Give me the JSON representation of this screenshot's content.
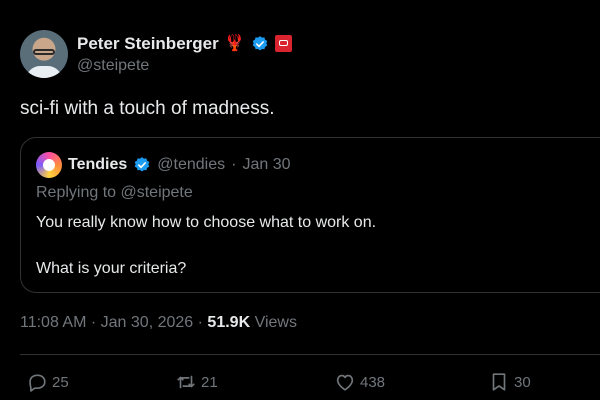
{
  "author": {
    "name": "Peter Steinberger",
    "handle": "@steipete",
    "emoji": "🦞"
  },
  "tweet": {
    "text": "sci-fi with a touch of madness."
  },
  "quote": {
    "name": "Tendies",
    "handle": "@tendies",
    "separator": "·",
    "date": "Jan 30",
    "reply_line": "Replying to @steipete",
    "line1": "You really know how to choose what to work on.",
    "line2": "What is your criteria?"
  },
  "meta": {
    "time": "11:08 AM",
    "separator1": "·",
    "date": "Jan 30, 2026",
    "separator2": "·",
    "views_count": "51.9K",
    "views_label": "Views"
  },
  "actions": {
    "replies": "25",
    "reposts": "21",
    "likes": "438",
    "bookmarks": "30"
  },
  "colors": {
    "background": "#000000",
    "text": "#e7e9ea",
    "muted": "#71767b",
    "border": "#2f3336",
    "verified": "#1d9bf0"
  }
}
